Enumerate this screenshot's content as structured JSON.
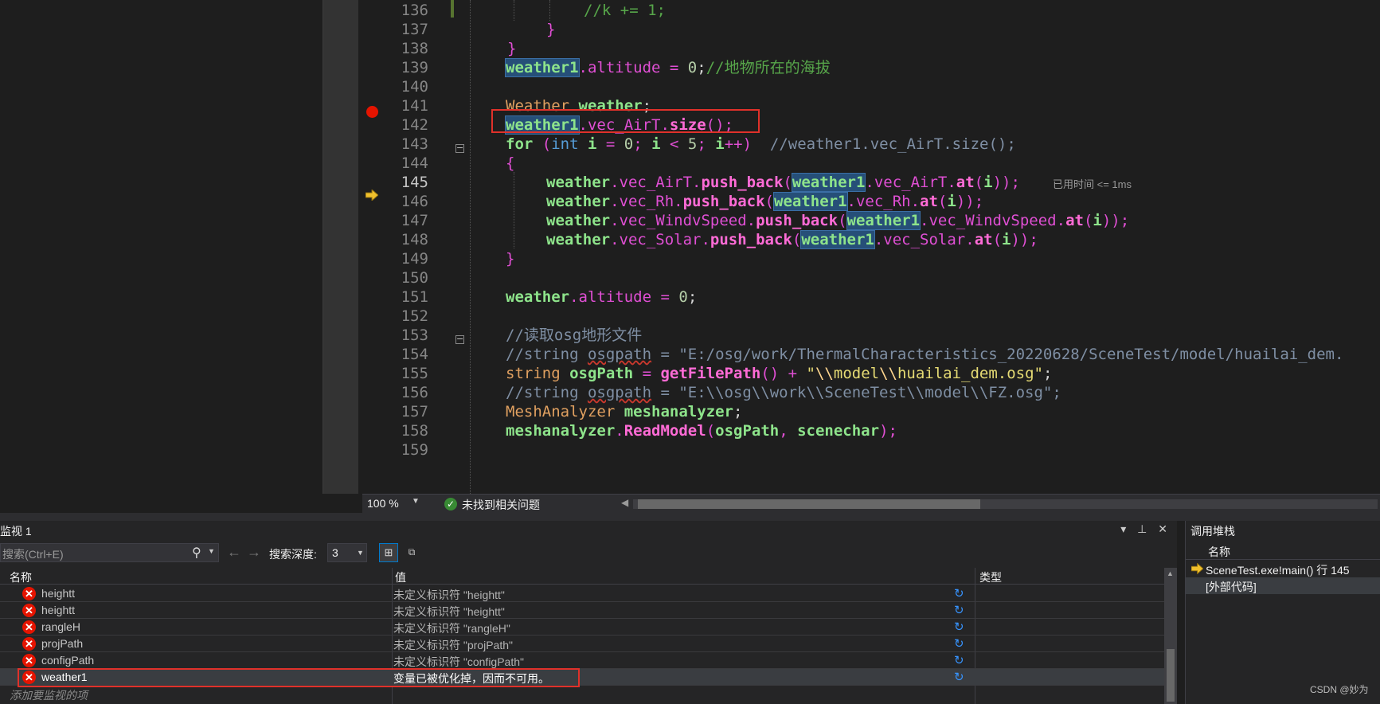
{
  "editor": {
    "line_numbers": [
      "136",
      "137",
      "138",
      "139",
      "140",
      "141",
      "142",
      "143",
      "144",
      "145",
      "146",
      "147",
      "148",
      "149",
      "150",
      "151",
      "152",
      "153",
      "154",
      "155",
      "156",
      "157",
      "158",
      "159"
    ],
    "current_line": "145",
    "elapsed_hint": "已用时间 <= 1ms",
    "code": {
      "l136": "//k += 1;",
      "l137": "}",
      "l138": "}",
      "l139_var": "weather1",
      "l139_rest": ".altitude = ",
      "l139_num": "0",
      "l139_semi": ";",
      "l139_comment": "//地物所在的海拔",
      "l141_type": "Weather",
      "l141_var": "weather",
      "l141_semi": ";",
      "l142_var": "weather1",
      "l142_mem": ".vec_AirT.",
      "l142_fn": "size",
      "l142_end": "();",
      "l143_for": "for",
      "l143_open": " (",
      "l143_int": "int",
      "l143_i": " i ",
      "l143_eq": "= ",
      "l143_zero": "0",
      "l143_semi1": "; ",
      "l143_i2": "i ",
      "l143_lt": "< ",
      "l143_five": "5",
      "l143_semi2": "; ",
      "l143_i3": "i",
      "l143_pp": "++)",
      "l143_comment": "//weather1.vec_AirT.size();",
      "l144": "{",
      "push_back": "push_back",
      "at": "at",
      "weather": "weather",
      "weather1": "weather1",
      "vec_airt": ".vec_AirT.",
      "vec_rh": ".vec_Rh.",
      "vec_wind": ".vec_WindvSpeed.",
      "vec_solar": ".vec_Solar.",
      "l149": "}",
      "l151_var": "weather",
      "l151_rest": ".altitude = ",
      "l151_num": "0",
      "l151_semi": ";",
      "l153": "//读取osg地形文件",
      "l154_a": "//string ",
      "l154_b": "osgpath",
      "l154_c": " = \"E:/osg/work/ThermalCharacteristics_20220628/SceneTest/model/huailai_dem.",
      "l155_type": "string",
      "l155_var": " osgPath",
      "l155_eq": " = ",
      "l155_fn": "getFilePath",
      "l155_paren": "() + ",
      "l155_q1": "\"",
      "l155_esc1": "\\\\",
      "l155_mid": "model",
      "l155_esc2": "\\\\",
      "l155_end": "huailai_dem.osg\"",
      "l155_semi": ";",
      "l156_a": "//string ",
      "l156_b": "osgpath",
      "l156_c": " = \"E:\\\\osg\\\\work\\\\SceneTest\\\\model\\\\FZ.osg\";",
      "l157_type": "MeshAnalyzer",
      "l157_var": " meshanalyzer",
      "l157_semi": ";",
      "l158_var": "meshanalyzer",
      "l158_dot": ".",
      "l158_fn": "ReadModel",
      "l158_open": "(",
      "l158_a1": "osgPath",
      "l158_comma": ", ",
      "l158_a2": "scenechar",
      "l158_end": ");"
    }
  },
  "status_bar": {
    "zoom": "100 %",
    "issues": "未找到相关问题"
  },
  "watch": {
    "title": "监视 1",
    "search_placeholder": "搜索(Ctrl+E)",
    "depth_label": "搜索深度:",
    "depth_value": "3",
    "columns": {
      "name": "名称",
      "value": "值",
      "type": "类型"
    },
    "rows": [
      {
        "name": "heightt",
        "value": "未定义标识符 \"heightt\""
      },
      {
        "name": "heightt",
        "value": "未定义标识符 \"heightt\""
      },
      {
        "name": "rangleH",
        "value": "未定义标识符 \"rangleH\""
      },
      {
        "name": "projPath",
        "value": "未定义标识符 \"projPath\""
      },
      {
        "name": "configPath",
        "value": "未定义标识符 \"configPath\""
      },
      {
        "name": "weather1",
        "value": "变量已被优化掉，因而不可用。"
      }
    ],
    "add_item": "添加要监视的项"
  },
  "callstack": {
    "title": "调用堆栈",
    "column": "名称",
    "rows": [
      "SceneTest.exe!main() 行 145",
      "[外部代码]"
    ]
  },
  "watermark": "CSDN @妙为",
  "colors": {
    "breakpoint": "#e51400",
    "highlight_box": "#e0312a",
    "accent": "#007acc"
  }
}
